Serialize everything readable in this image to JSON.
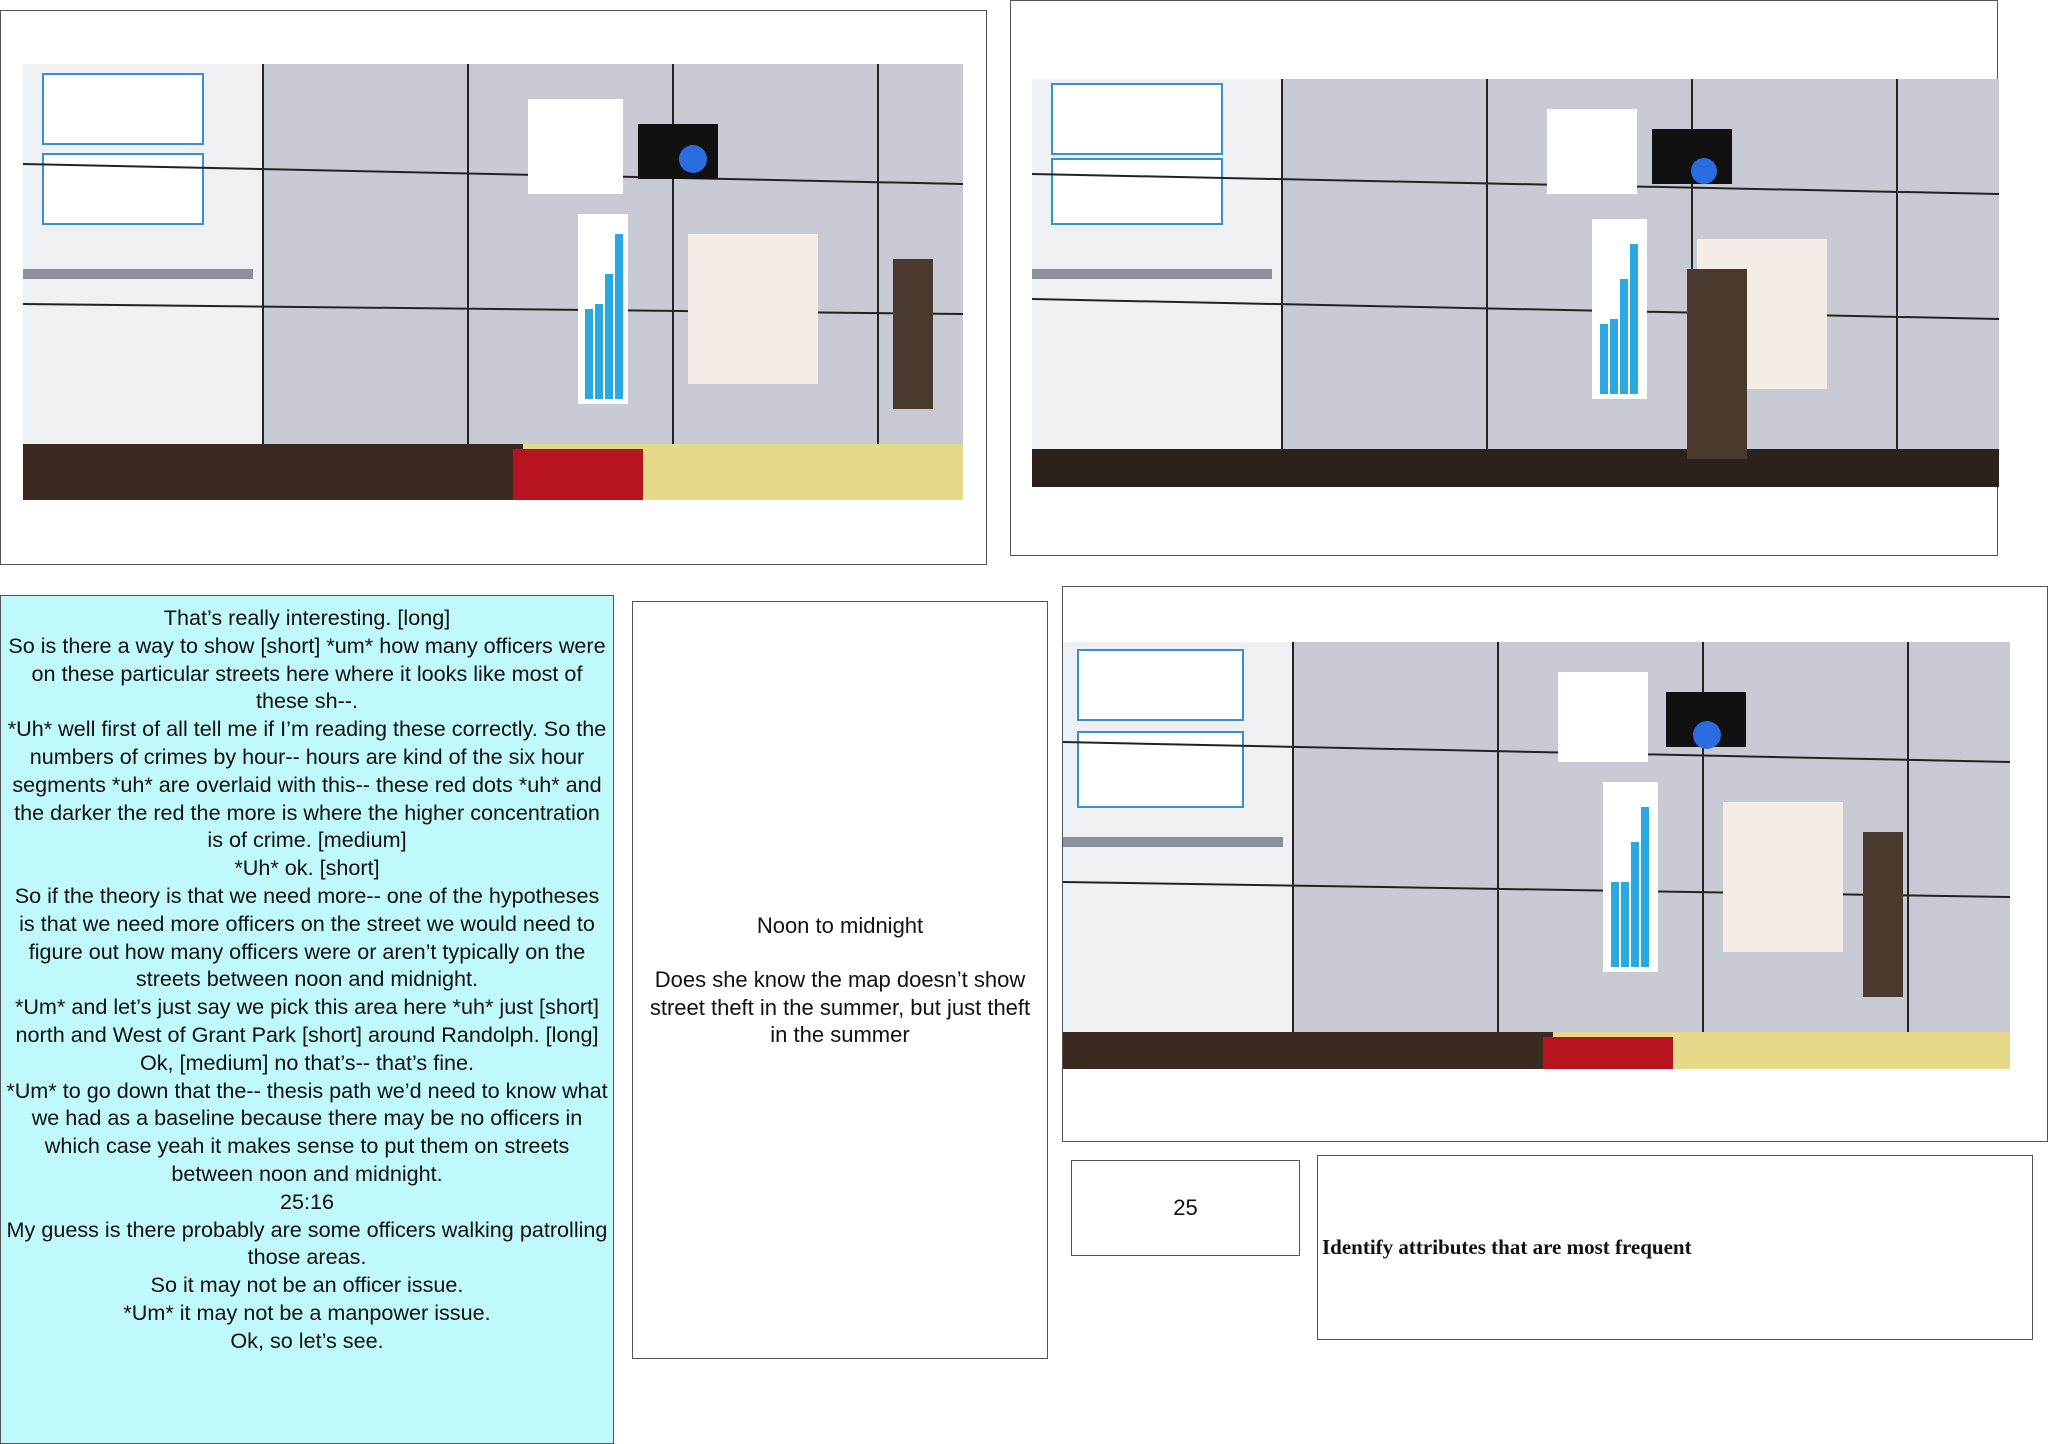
{
  "photos": [
    {
      "name": "photo-wall-1",
      "caption": ""
    },
    {
      "name": "photo-wall-2",
      "caption": ""
    },
    {
      "name": "photo-wall-3",
      "caption": ""
    }
  ],
  "transcript": {
    "lines": [
      "That’s really interesting. [long]",
      "So is there a way to show [short] *um* how many officers were on these particular streets here where it looks like most of these sh--.",
      "*Uh* well first of all tell me if I’m reading these correctly. So the numbers of crimes by hour-- hours are kind of the six hour segments *uh* are overlaid with this-- these red dots *uh* and the darker the red the more is where the higher concentration is of crime. [medium]",
      "*Uh* ok. [short]",
      "So if the theory is that we need more-- one of the hypotheses is that we need more officers on the street we would need to figure out how many officers were or aren’t typically on the streets between noon and midnight.",
      "*Um* and let’s just say we pick this area here *uh* just [short] north and West of Grant Park [short] around Randolph. [long]",
      "Ok, [medium] no that’s-- that’s fine.",
      "*Um* to go down that the-- thesis path we’d need to know what we had as a baseline because there may be no officers in which case yeah it makes sense to put them on streets between noon and midnight.",
      "25:16",
      "My guess is there probably are some officers walking patrolling those areas.",
      "So it may not be an officer issue.",
      "*Um* it may not be a manpower issue.",
      "Ok, so let’s see."
    ]
  },
  "note": {
    "title": "Noon to midnight",
    "body": "Does she know the map doesn’t show street theft in the summer, but just theft in the summer"
  },
  "number_box": {
    "value": "25"
  },
  "task_box": {
    "label": "Identify attributes that are most frequent"
  },
  "colors": {
    "transcript_bg": "#bff9fb",
    "bar_blue": "#2aa8e0",
    "wall_gray": "#c9ccd4"
  }
}
